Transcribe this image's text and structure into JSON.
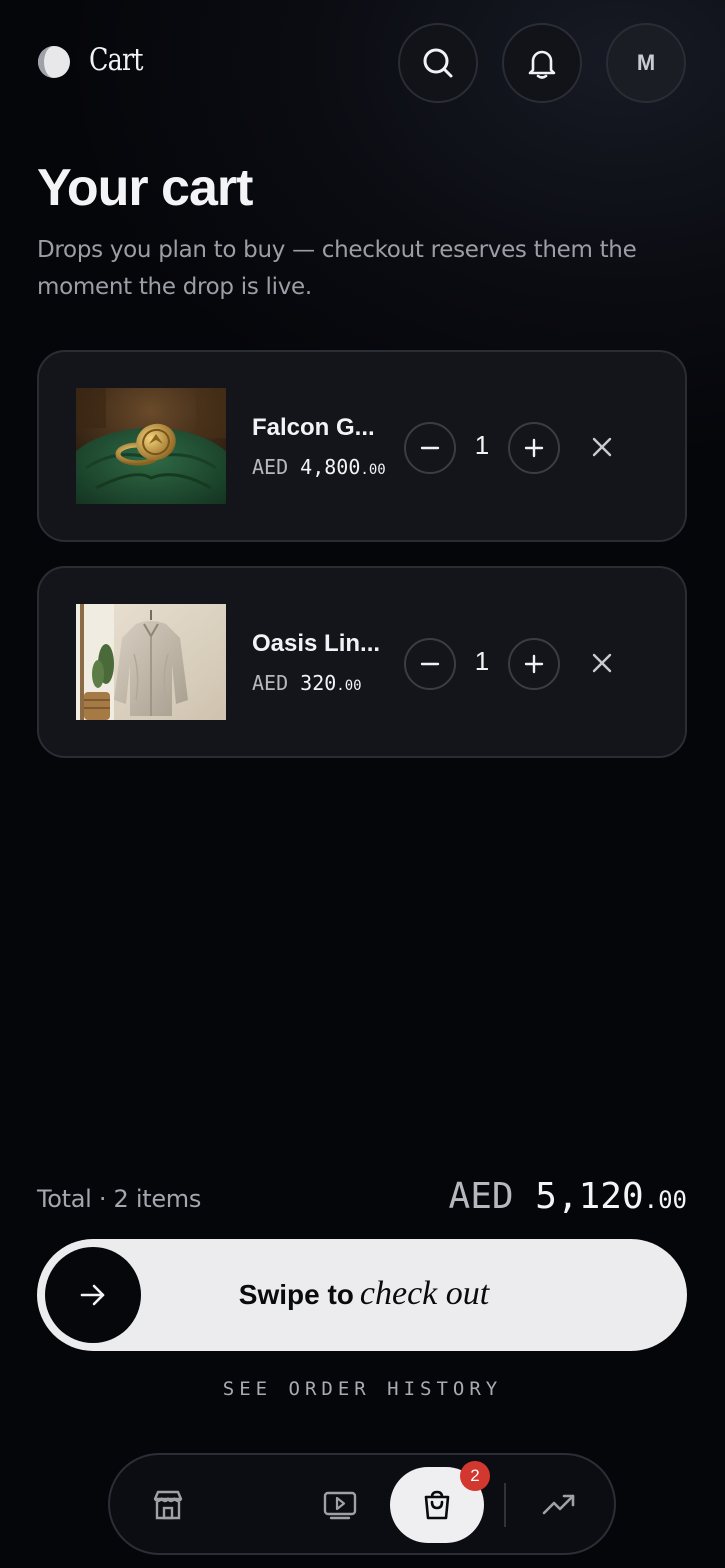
{
  "header": {
    "title": "Cart",
    "avatar_initial": "M",
    "icons": [
      "search-icon",
      "bell-icon"
    ]
  },
  "page": {
    "title": "Your cart",
    "subtitle": "Drops you plan to buy — checkout reserves them the moment the drop is live."
  },
  "items": [
    {
      "name": "Falcon G...",
      "currency": "AED",
      "price_main": "4,800",
      "price_cents": ".00",
      "quantity": "1",
      "image": "ring-on-green-velvet"
    },
    {
      "name": "Oasis Lin...",
      "currency": "AED",
      "price_main": "320",
      "price_cents": ".00",
      "quantity": "1",
      "image": "linen-shirt-on-hanger"
    }
  ],
  "summary": {
    "label": "Total · 2 items",
    "currency": "AED",
    "amount_main": "5,120",
    "amount_cents": ".00"
  },
  "checkout": {
    "label_plain": "Swipe to",
    "label_italic": "check out"
  },
  "history_link": "SEE ORDER HISTORY",
  "nav": {
    "items": [
      "store-icon",
      "video-icon",
      "cart-icon",
      "trending-icon"
    ],
    "active": "cart-icon",
    "cart_badge": "2"
  },
  "colors": {
    "background": "#05060a",
    "card": "#13151a",
    "badge": "#d2382f",
    "swipe_track": "#ececef"
  }
}
